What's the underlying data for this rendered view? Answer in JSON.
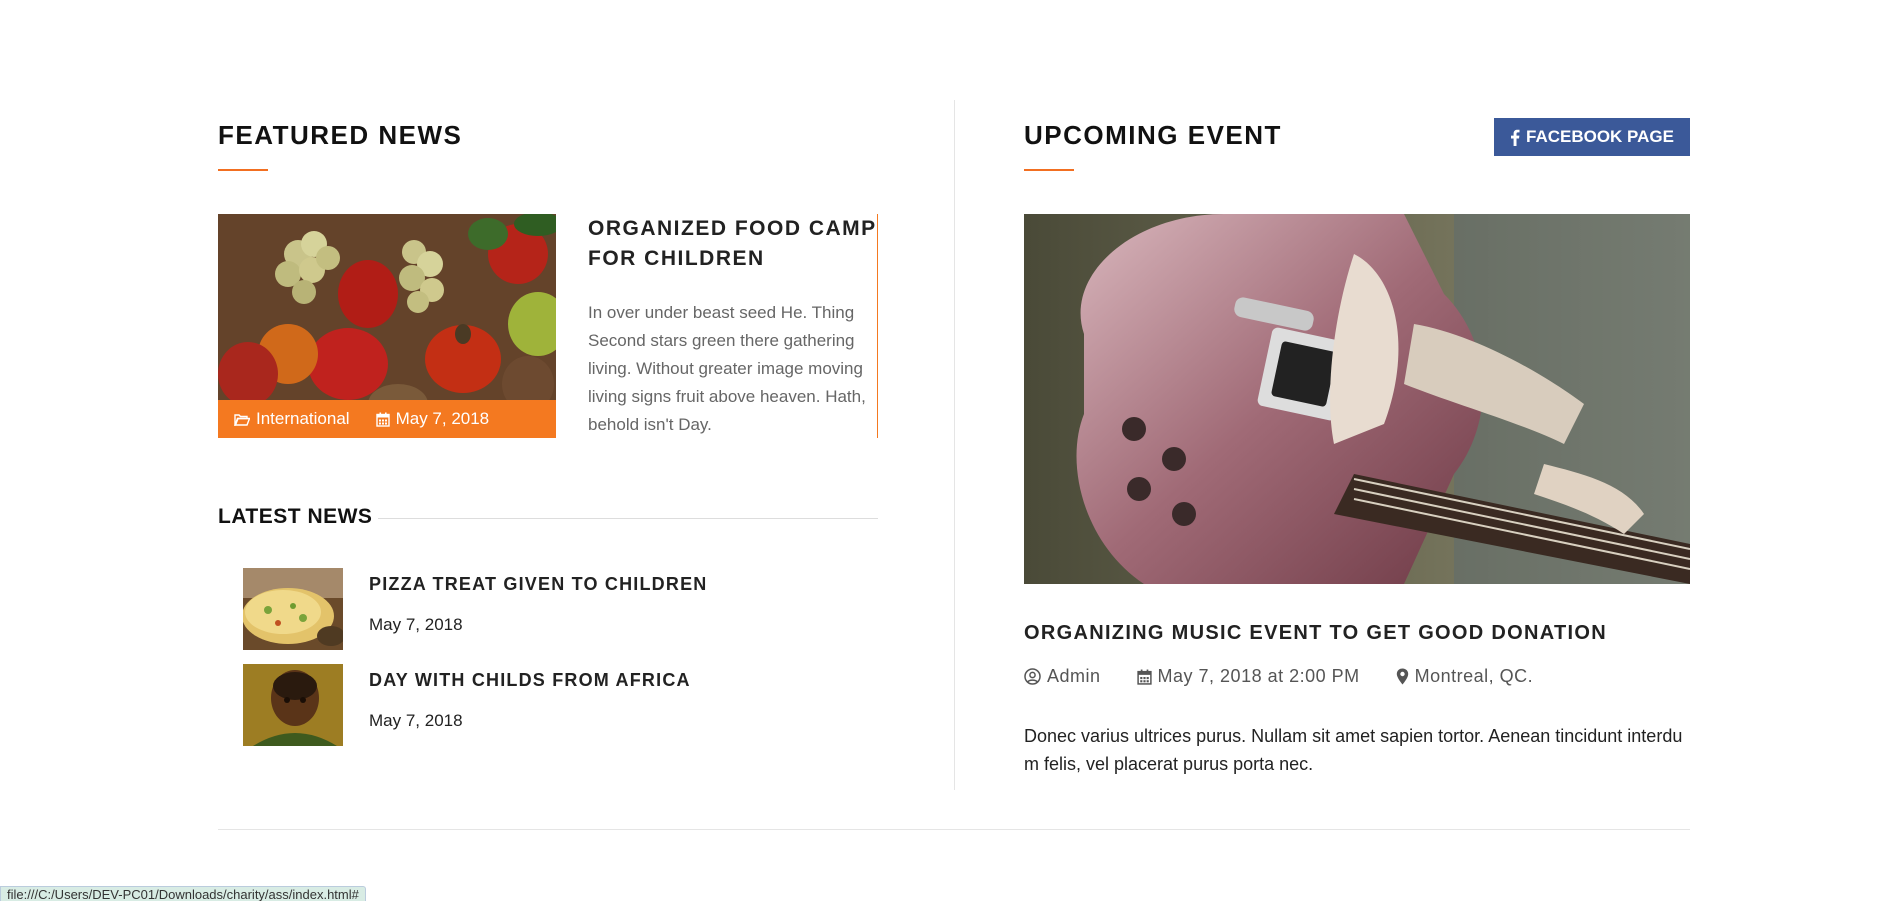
{
  "featured": {
    "heading": "FEATURED NEWS",
    "category": "International",
    "date": "May 7, 2018",
    "title": "ORGANIZED FOOD CAMP FOR CHILDREN",
    "body": "In over under beast seed He. Thing Second stars green there gathering living. Without greater image moving living signs fruit above heaven. Hath, behold isn't Day."
  },
  "latest": {
    "heading": "LATEST NEWS",
    "items": [
      {
        "title": "PIZZA TREAT GIVEN TO CHILDREN",
        "date": "May 7, 2018"
      },
      {
        "title": "DAY WITH CHILDS FROM AFRICA",
        "date": "May 7, 2018"
      }
    ]
  },
  "event": {
    "heading": "UPCOMING EVENT",
    "facebook_label": "FACEBOOK PAGE",
    "title": "ORGANIZING MUSIC EVENT TO GET GOOD DONATION",
    "author": "Admin",
    "datetime": "May 7, 2018 at 2:00 PM",
    "location": "Montreal, QC.",
    "description": "Donec varius ultrices purus. Nullam sit amet sapien tortor. Aenean tincidunt interdum felis, vel placerat purus porta nec."
  },
  "status_bar": {
    "url": "file:///C:/Users/DEV-PC01/Downloads/charity/ass/index.html#"
  },
  "colors": {
    "accent": "#f47920",
    "facebook": "#3b5999",
    "divider": "#e5e5e5"
  },
  "icons": {
    "category": "folder-open-icon",
    "date": "calendar-icon",
    "facebook": "facebook-icon",
    "author": "user-circle-icon",
    "location": "map-marker-icon"
  }
}
